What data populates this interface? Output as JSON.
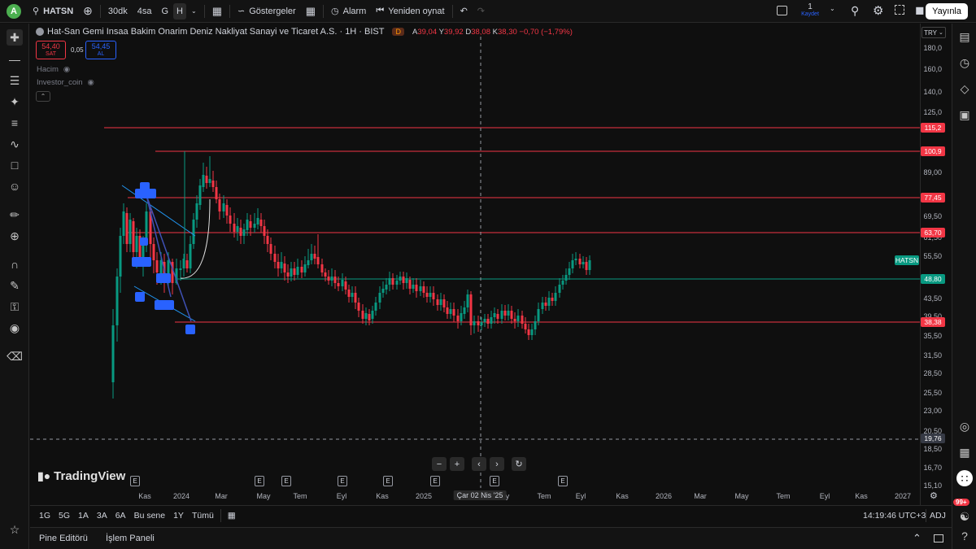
{
  "topbar": {
    "avatar_letter": "A",
    "symbol": "HATSN",
    "intervals": [
      "30dk",
      "4sa",
      "G",
      "H"
    ],
    "indicators_label": "Göstergeler",
    "alarm_label": "Alarm",
    "replay_label": "Yeniden oynat",
    "save_count": "1",
    "save_label": "Kaydet",
    "publish_label": "Yayınla"
  },
  "legend": {
    "title": "Hat-San Gemi Insaa Bakim Onarim Deniz Nakliyat Sanayi ve Ticaret A.S. · 1H · BIST",
    "d_badge": "D",
    "o_k": "A",
    "o_v": "39,04",
    "h_k": "Y",
    "h_v": "39,92",
    "l_k": "D",
    "l_v": "38,08",
    "c_k": "K",
    "c_v": "38,30",
    "change": "−0,70 (−1,79%)",
    "sell_price": "54,40",
    "sell_label": "SAT",
    "spread": "0,05",
    "buy_price": "54,45",
    "buy_label": "AL",
    "indicator1": "Hacim",
    "indicator2": "Investor_coin"
  },
  "price_scale": {
    "currency": "TRY",
    "labels": [
      "180,0",
      "160,0",
      "140,0",
      "125,0",
      "89,00",
      "69,50",
      "61,50",
      "55,50",
      "43,50",
      "39,50",
      "35,50",
      "31,50",
      "28,50",
      "25,50",
      "23,00",
      "20,50",
      "18,50",
      "16,70",
      "15,10"
    ],
    "tags": [
      {
        "value": "115,2",
        "color": "#f23645"
      },
      {
        "value": "100,9",
        "color": "#f23645"
      },
      {
        "value": "77,45",
        "color": "#f23645"
      },
      {
        "value": "63,70",
        "color": "#f23645"
      },
      {
        "value": "HATSN",
        "color": "#089981"
      },
      {
        "value": "48,80",
        "color": "#089981"
      },
      {
        "value": "38,38",
        "color": "#f23645"
      },
      {
        "value": "19,76",
        "color": "#363a45"
      }
    ]
  },
  "time_scale": {
    "labels": [
      "Kas",
      "2024",
      "Mar",
      "May",
      "Tem",
      "Eyl",
      "Kas",
      "2025",
      "Çar 02 Nis '25",
      "y",
      "Tem",
      "Eyl",
      "Kas",
      "2026",
      "Mar",
      "May",
      "Tem",
      "Eyl",
      "Kas",
      "2027"
    ]
  },
  "events_label": "E",
  "logo_text": "TradingView",
  "bottom": {
    "ranges": [
      "1G",
      "5G",
      "1A",
      "3A",
      "6A",
      "Bu sene",
      "1Y",
      "Tümü"
    ],
    "clock": "14:19:46 UTC+3",
    "adj": "ADJ"
  },
  "footer": {
    "pine_editor": "Pine Editörü",
    "trade_panel": "İşlem Paneli"
  },
  "notifications_badge": "99+",
  "colors": {
    "up": "#089981",
    "down": "#f23645",
    "accent": "#2962ff"
  }
}
